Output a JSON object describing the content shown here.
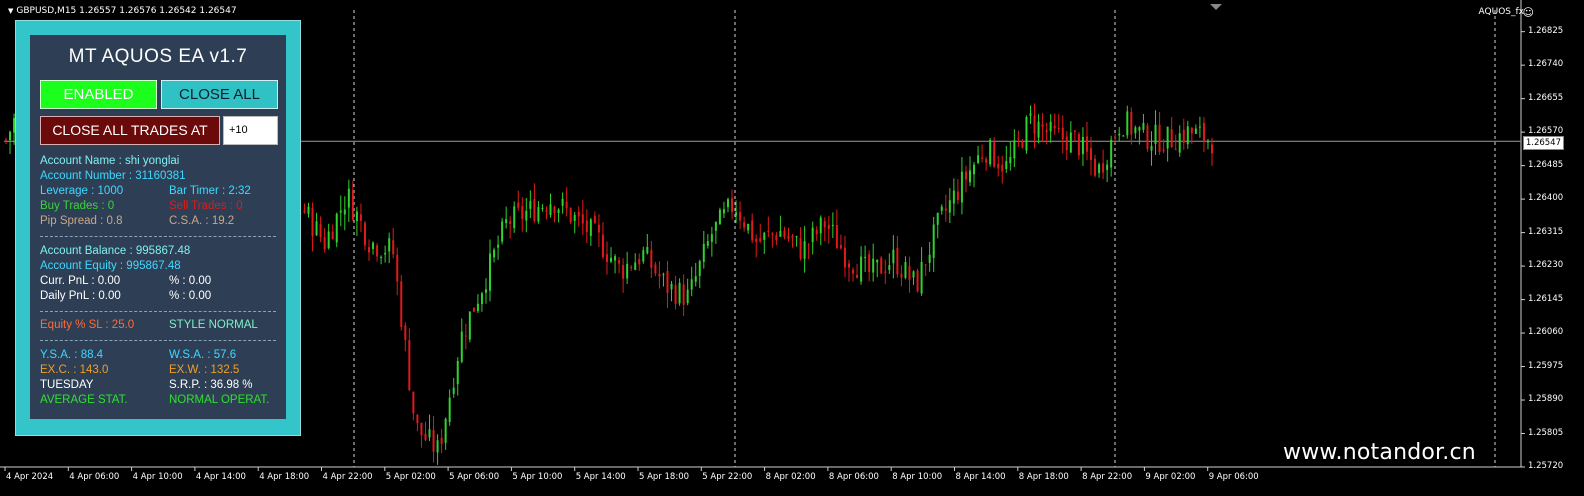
{
  "symbol_header": "GBPUSD,M15  1.26557 1.26576 1.26542 1.26547",
  "ea_tag": "AQUOS_fx",
  "current_price": "1.26547",
  "watermark": "www.notandor.cn",
  "colors": {
    "bull": "#2fd22f",
    "bear": "#e01a1a",
    "panel_border": "#33c5c9",
    "panel_bg": "#2e3f55"
  },
  "chart_data": {
    "type": "candlestick",
    "symbol": "GBPUSD",
    "timeframe": "M15",
    "ylim": [
      1.2572,
      1.2688
    ],
    "y_ticks": [
      "1.26825",
      "1.26740",
      "1.26655",
      "1.26570",
      "1.26485",
      "1.26400",
      "1.26315",
      "1.26230",
      "1.26145",
      "1.26060",
      "1.25975",
      "1.25890",
      "1.25805",
      "1.25720"
    ],
    "x_ticks": [
      "4 Apr 2024",
      "4 Apr 06:00",
      "4 Apr 10:00",
      "4 Apr 14:00",
      "4 Apr 18:00",
      "4 Apr 22:00",
      "5 Apr 02:00",
      "5 Apr 06:00",
      "5 Apr 10:00",
      "5 Apr 14:00",
      "5 Apr 18:00",
      "5 Apr 22:00",
      "8 Apr 02:00",
      "8 Apr 06:00",
      "8 Apr 10:00",
      "8 Apr 14:00",
      "8 Apr 18:00",
      "8 Apr 22:00",
      "9 Apr 02:00",
      "9 Apr 06:00"
    ],
    "close_path": [
      [
        0,
        1.2655
      ],
      [
        1,
        1.2669
      ],
      [
        2,
        1.2656
      ],
      [
        3,
        1.2643
      ],
      [
        4,
        1.2641
      ],
      [
        5,
        1.2645
      ],
      [
        6,
        1.264
      ],
      [
        7,
        1.2648
      ],
      [
        8,
        1.2628
      ],
      [
        9,
        1.2624
      ],
      [
        10,
        1.2628
      ],
      [
        11,
        1.2615
      ],
      [
        12,
        1.2625
      ],
      [
        13,
        1.2638
      ],
      [
        14,
        1.2629
      ],
      [
        15,
        1.2641
      ],
      [
        16,
        1.2629
      ],
      [
        17,
        1.2627
      ],
      [
        18,
        1.2582
      ],
      [
        19,
        1.2576
      ],
      [
        20,
        1.2605
      ],
      [
        21,
        1.2619
      ],
      [
        22,
        1.2634
      ],
      [
        23,
        1.2637
      ],
      [
        24,
        1.264
      ],
      [
        25,
        1.2635
      ],
      [
        26,
        1.263
      ],
      [
        27,
        1.2622
      ],
      [
        28,
        1.2626
      ],
      [
        29,
        1.2618
      ],
      [
        30,
        1.2615
      ],
      [
        31,
        1.2631
      ],
      [
        32,
        1.2639
      ],
      [
        33,
        1.2629
      ],
      [
        34,
        1.2632
      ],
      [
        35,
        1.2627
      ],
      [
        36,
        1.2634
      ],
      [
        37,
        1.2625
      ],
      [
        38,
        1.2621
      ],
      [
        39,
        1.2625
      ],
      [
        40,
        1.2618
      ],
      [
        41,
        1.2634
      ],
      [
        42,
        1.2644
      ],
      [
        43,
        1.2653
      ],
      [
        44,
        1.2648
      ],
      [
        45,
        1.266
      ],
      [
        46,
        1.2656
      ],
      [
        47,
        1.2655
      ],
      [
        48,
        1.2647
      ],
      [
        49,
        1.266
      ],
      [
        50,
        1.2656
      ],
      [
        51,
        1.2655
      ],
      [
        52,
        1.2657
      ],
      [
        53,
        1.2655
      ]
    ],
    "hline": 1.26547
  },
  "panel": {
    "title": "MT  AQUOS EA  v1.7",
    "enabled_label": "ENABLED",
    "close_all_label": "CLOSE ALL",
    "close_all_at_label": "CLOSE ALL TRADES AT",
    "close_at_value": "+10",
    "account_name": "Account Name : shi yonglai",
    "account_number": "Account Number : 31160381",
    "leverage": "Leverage : 1000",
    "bar_timer": "Bar Timer : 2:32",
    "buy_trades": "Buy Trades : 0",
    "sell_trades": "Sell Trades : 0",
    "pip_spread": "Pip Spread : 0.8",
    "csa": "C.S.A. : 19.2",
    "balance": "Account Balance : 995867.48",
    "equity": "Account Equity : 995867.48",
    "curr_pnl": "Curr. PnL : 0.00",
    "curr_pct": "% : 0.00",
    "daily_pnl": "Daily PnL : 0.00",
    "daily_pct": "% : 0.00",
    "equity_sl": "Equity % SL : 25.0",
    "style": "STYLE NORMAL",
    "ysa": "Y.S.A. : 88.4",
    "wsa": "W.S.A. : 57.6",
    "exc": "EX.C. : 143.0",
    "exw": "EX.W. : 132.5",
    "day": "TUESDAY",
    "srp": "S.R.P. : 36.98 %",
    "avg_stat": "AVERAGE STAT.",
    "operat": "NORMAL OPERAT."
  }
}
